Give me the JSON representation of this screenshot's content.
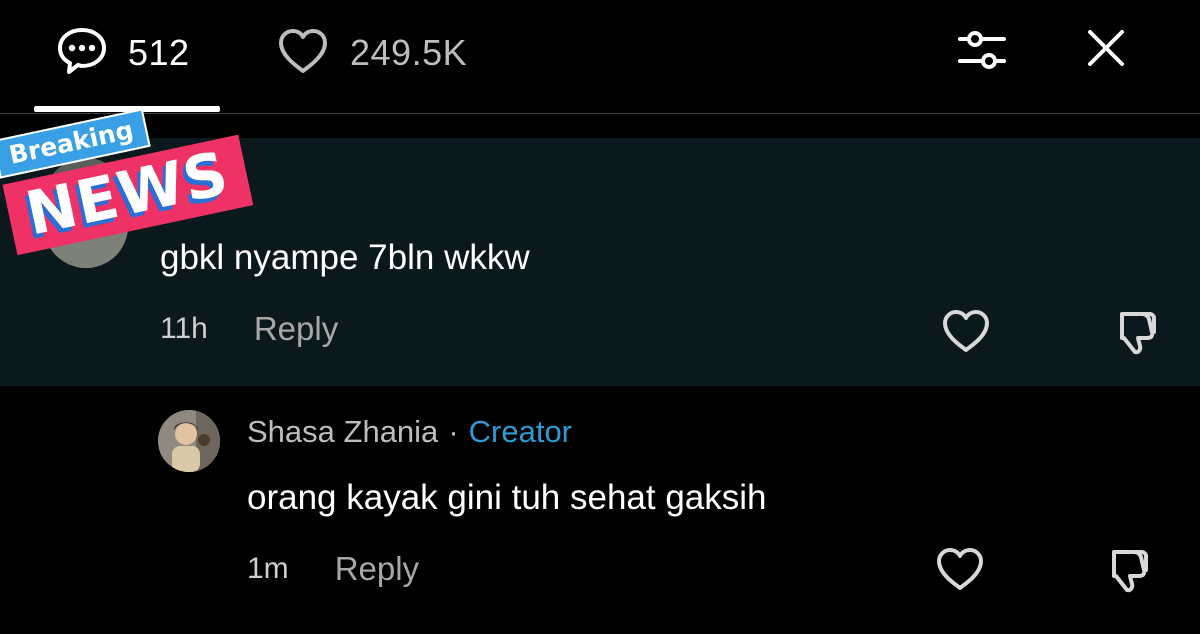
{
  "header": {
    "comments_count": "512",
    "likes_count": "249.5K",
    "active_tab": "comments"
  },
  "comments": [
    {
      "text": "gbkl nyampe 7bln wkkw",
      "time": "11h",
      "reply_label": "Reply",
      "highlighted": true,
      "sticker": {
        "top": "Breaking",
        "bottom": "NEWS"
      }
    },
    {
      "author": "Shasa Zhania",
      "separator": "·",
      "badge": "Creator",
      "text": "orang kayak gini tuh sehat gaksih",
      "time": "1m",
      "reply_label": "Reply"
    }
  ],
  "colors": {
    "background": "#000000",
    "highlight": "#0b181c",
    "creator_badge": "#2e9ad6",
    "secondary_text": "#a8a8a8"
  },
  "icons": [
    "comment-bubble-icon",
    "heart-icon",
    "filter-sliders-icon",
    "close-icon",
    "thumbs-down-icon"
  ]
}
